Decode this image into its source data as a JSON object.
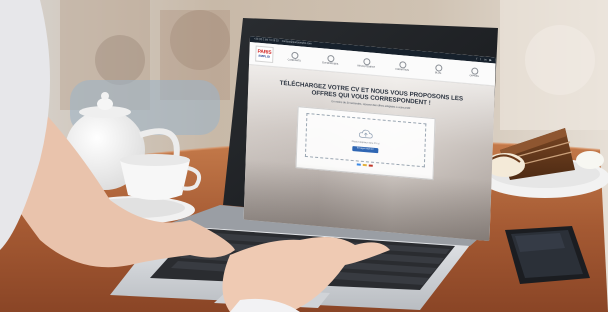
{
  "screen": {
    "topbar": {
      "phone": "+33 (0) 1 84 74 19 22",
      "email": "contact@parisemploi.com",
      "social_icons": [
        "facebook-icon",
        "twitter-icon",
        "linkedin-icon",
        "youtube-icon"
      ]
    },
    "logo": {
      "line1": "PARIS",
      "line2": "EMPLOI"
    },
    "nav": {
      "items": [
        {
          "label": "Candidats",
          "icon": "user-icon"
        },
        {
          "label": "Entreprises",
          "icon": "building-icon"
        },
        {
          "label": "Recrutement",
          "icon": "briefcase-icon"
        },
        {
          "label": "Formation",
          "icon": "book-icon"
        },
        {
          "label": "Blog",
          "icon": "pen-icon"
        },
        {
          "label": "Offres",
          "icon": "list-icon"
        }
      ]
    },
    "hero": {
      "title_line1": "Téléchargez votre CV et nous vous proposons les",
      "title_line2": "offres qui vous correspondent !",
      "subtitle": "En moins de 30 secondes, recevez des offres adaptées à votre profil"
    },
    "dropzone": {
      "text": "Glissez-déposez votre CV ici",
      "button_label": "Envoyer mon CV"
    }
  },
  "colors": {
    "topbar": "#17212c",
    "accent_button": "#2f66b3",
    "logo_red": "#d22a2a",
    "logo_blue": "#1f3f8f",
    "table_wood": "#b5643a"
  }
}
